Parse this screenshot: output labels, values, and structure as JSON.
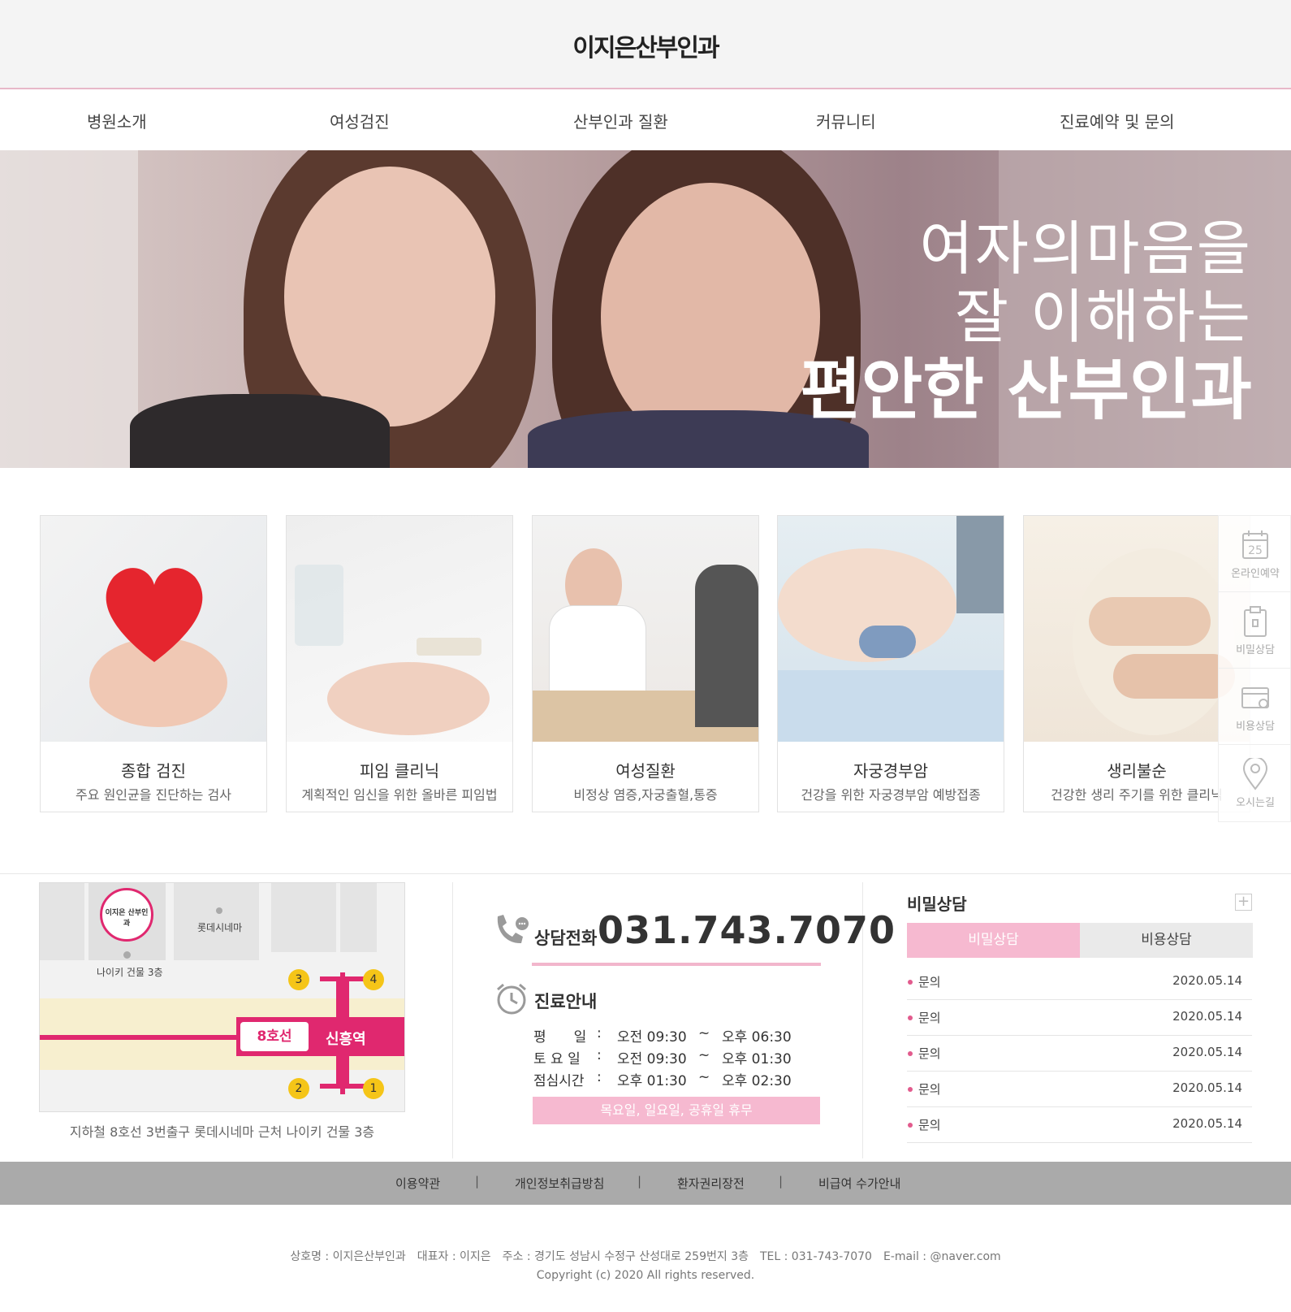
{
  "header": {
    "logo": "이지은산부인과"
  },
  "nav": {
    "items": [
      {
        "label": "병원소개"
      },
      {
        "label": "여성검진"
      },
      {
        "label": "산부인과 질환"
      },
      {
        "label": "커뮤니티"
      },
      {
        "label": "진료예약 및 문의"
      }
    ]
  },
  "hero": {
    "line1": "여자의마음을",
    "line2": "잘 이해하는",
    "line3": "편안한 산부인과"
  },
  "cards": [
    {
      "title": "종합 검진",
      "desc": "주요 원인균을 진단하는 검사"
    },
    {
      "title": "피임 클리닉",
      "desc": "계획적인 임신을 위한 올바른 피임법"
    },
    {
      "title": "여성질환",
      "desc": "비정상 염증,자궁출혈,통증"
    },
    {
      "title": "자궁경부암",
      "desc": "건강을 위한 자궁경부암 예방접종"
    },
    {
      "title": "생리불순",
      "desc": "건강한 생리 주기를 위한 클리닉"
    }
  ],
  "quick_menu": {
    "calendar_day": "25",
    "items": [
      {
        "label": "온라인예약",
        "icon": "calendar-icon"
      },
      {
        "label": "비밀상담",
        "icon": "clipboard-icon"
      },
      {
        "label": "비용상담",
        "icon": "card-icon"
      },
      {
        "label": "오시는길",
        "icon": "map-pin-icon"
      }
    ]
  },
  "map": {
    "logo_text": "이지은 산부인과",
    "building": "나이키 건물 3층",
    "cinema": "롯데시네마",
    "line": "8호선",
    "station": "신흥역",
    "exits": [
      "3",
      "4",
      "2",
      "1"
    ],
    "caption": "지하철 8호선 3번출구 롯데시네마 근처 나이키 건물 3층"
  },
  "contact": {
    "phone_label": "상담전화",
    "phone_number": "031.743.7070",
    "hours_title": "진료안내",
    "hours": [
      {
        "day": "평　　일",
        "colon": ":",
        "open": "오전 09:30",
        "tilde": "~",
        "close": "오후 06:30"
      },
      {
        "day": "토 요 일",
        "colon": ":",
        "open": "오전 09:30",
        "tilde": "~",
        "close": "오후 01:30"
      },
      {
        "day": "점심시간",
        "colon": ":",
        "open": "오후 01:30",
        "tilde": "~",
        "close": "오후 02:30"
      }
    ],
    "closed": "목요일, 일요일, 공휴일 휴무"
  },
  "counsel": {
    "title": "비밀상담",
    "plus": "+",
    "tabs": [
      {
        "label": "비밀상담"
      },
      {
        "label": "비용상담"
      }
    ],
    "rows": [
      {
        "title": "문의",
        "date": "2020.05.14"
      },
      {
        "title": "문의",
        "date": "2020.05.14"
      },
      {
        "title": "문의",
        "date": "2020.05.14"
      },
      {
        "title": "문의",
        "date": "2020.05.14"
      },
      {
        "title": "문의",
        "date": "2020.05.14"
      }
    ]
  },
  "footer": {
    "links": [
      {
        "label": "이용약관"
      },
      {
        "label": "개인정보취급방침"
      },
      {
        "label": "환자권리장전"
      },
      {
        "label": "비급여 수가안내"
      }
    ],
    "pipe": "|",
    "info": "상호명 : 이지은산부인과　대표자 : 이지은　주소 : 경기도 성남시 수정구 산성대로 259번지 3층　TEL : 031-743-7070　E-mail : @naver.com",
    "copyright": "Copyright (c) 2020 All rights reserved."
  },
  "colors": {
    "accent": "#f6b9d0",
    "accent_dark": "#e0286f",
    "dot": "#e25b8d"
  }
}
